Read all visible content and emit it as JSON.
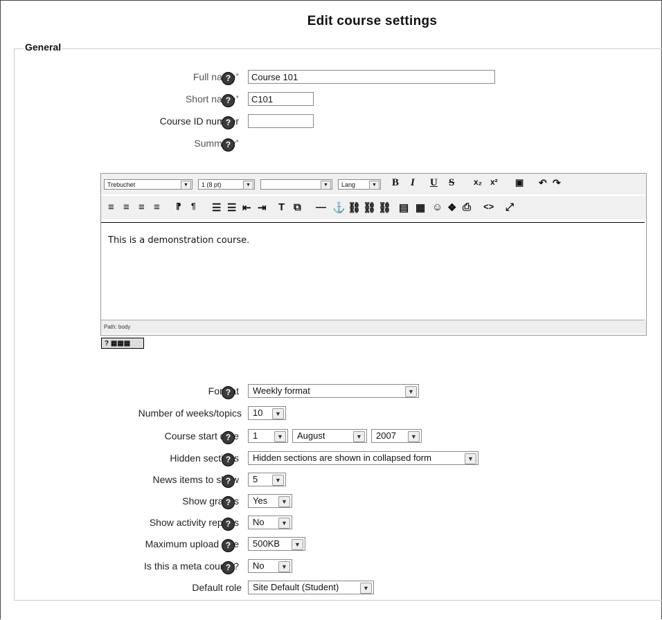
{
  "page_title": "Edit course settings",
  "section_legend": "General",
  "fields": {
    "full_name": {
      "label": "Full name",
      "required": "*",
      "value": "Course 101"
    },
    "short_name": {
      "label": "Short name",
      "required": "*",
      "value": "C101"
    },
    "course_id": {
      "label": "Course ID number",
      "value": ""
    },
    "summary": {
      "label": "Summary",
      "required": "*"
    }
  },
  "help_glyph": "?",
  "editor": {
    "font_family": "Trebuchet",
    "font_size": "1 (8 pt)",
    "heading": "",
    "lang": "Lang",
    "content": "This is a demonstration course.",
    "path": "Path: body",
    "keyboard_button": "?"
  },
  "toolbar_row1_icons": [
    "B",
    "I",
    "U",
    "S",
    "x₂",
    "x²",
    "▣",
    "↶",
    "↷"
  ],
  "toolbar_row2_icons": [
    "≡",
    "≡",
    "≡",
    "≡",
    "⁋",
    "¶",
    "☰",
    "☰",
    "⇤",
    "⇥",
    "T",
    "⧉",
    "—",
    "⚓",
    "⛓",
    "⛓",
    "⛓",
    "▤",
    "▦",
    "☺",
    "❖",
    "⎙",
    "<>",
    "⤢"
  ],
  "settings": {
    "format": {
      "label": "Format",
      "value": "Weekly format"
    },
    "weeks": {
      "label": "Number of weeks/topics",
      "value": "10"
    },
    "start_date": {
      "label": "Course start date",
      "day": "1",
      "month": "August",
      "year": "2007"
    },
    "hidden_sections": {
      "label": "Hidden sections",
      "value": "Hidden sections are shown in collapsed form"
    },
    "news_items": {
      "label": "News items to show",
      "value": "5"
    },
    "show_grades": {
      "label": "Show grades",
      "value": "Yes"
    },
    "activity_reports": {
      "label": "Show activity reports",
      "value": "No"
    },
    "max_upload": {
      "label": "Maximum upload size",
      "value": "500KB"
    },
    "meta_course": {
      "label": "Is this a meta course?",
      "value": "No"
    },
    "default_role": {
      "label": "Default role",
      "value": "Site Default (Student)"
    }
  },
  "dropdown_arrow": "▼"
}
